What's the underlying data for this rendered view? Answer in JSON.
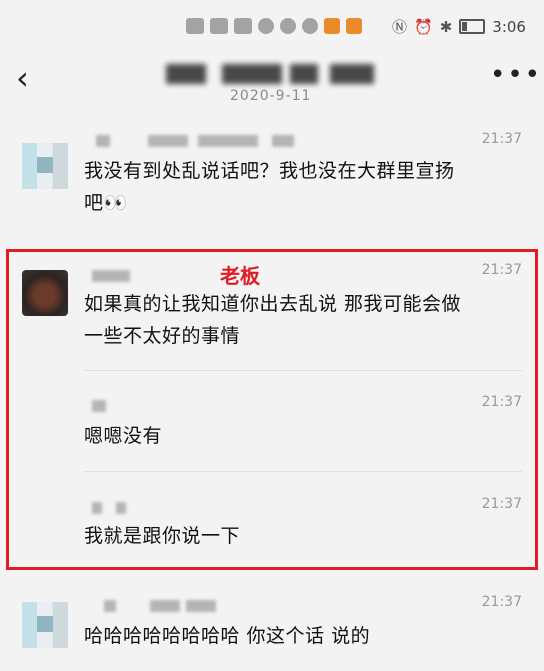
{
  "status_bar": {
    "time": "3:06"
  },
  "nav": {
    "date": "2020-9-11",
    "back_icon": "‹",
    "more_icon": "•••"
  },
  "annotation": {
    "label": "老板",
    "color": "#e01b24"
  },
  "messages": [
    {
      "time": "21:37",
      "text_line1": "我没有到处乱说话吧？我也没在大群里宣扬",
      "text_line2": "吧👀"
    },
    {
      "time": "21:37",
      "text_line1": "如果真的让我知道你出去乱说 那我可能会做",
      "text_line2": "一些不太好的事情"
    },
    {
      "time": "21:37",
      "text_line1": "嗯嗯没有"
    },
    {
      "time": "21:37",
      "text_line1": "我就是跟你说一下"
    },
    {
      "time": "21:37",
      "text_line1": "哈哈哈哈哈哈哈哈 你这个话 说的"
    }
  ]
}
